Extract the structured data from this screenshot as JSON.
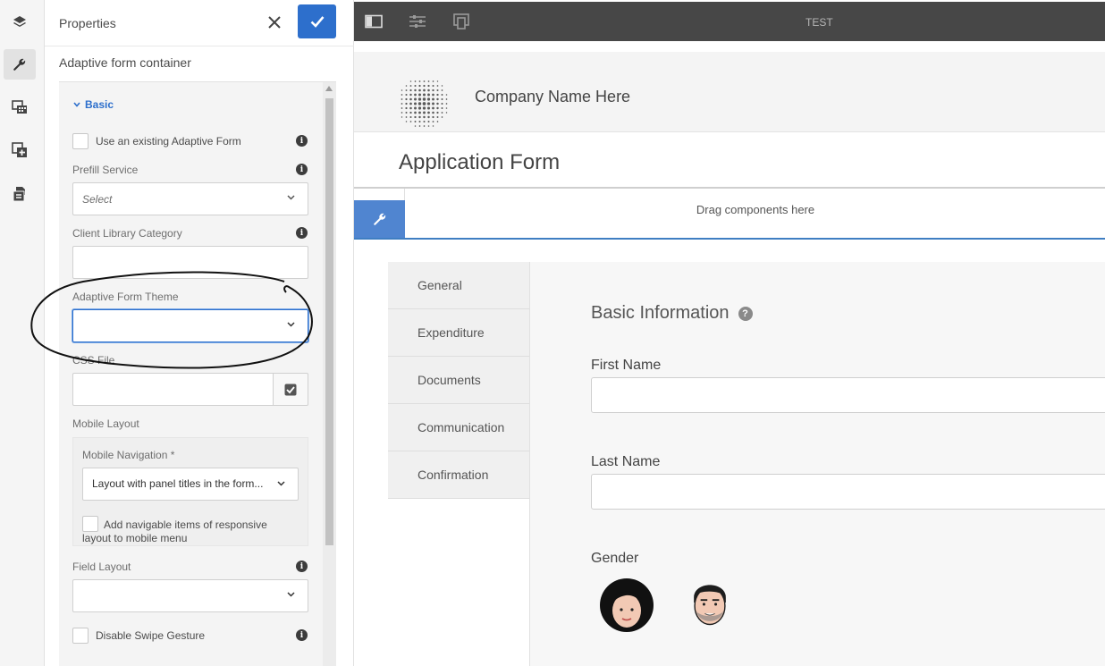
{
  "panel": {
    "title": "Properties",
    "subtitle": "Adaptive form container",
    "section": "Basic",
    "use_existing_label": "Use an existing Adaptive Form",
    "prefill_label": "Prefill Service",
    "prefill_placeholder": "Select",
    "client_lib_label": "Client Library Category",
    "theme_label": "Adaptive Form Theme",
    "css_file_label": "CSS File",
    "mobile_layout_label": "Mobile Layout",
    "mobile_nav_label": "Mobile Navigation *",
    "mobile_nav_value": "Layout with panel titles in the form...",
    "add_navigable_label": "Add navigable items of responsive layout to mobile menu",
    "field_layout_label": "Field Layout",
    "disable_swipe_label": "Disable Swipe Gesture"
  },
  "canvas": {
    "top_title": "TEST",
    "company": "Company Name Here",
    "form_title": "Application Form",
    "drag_text": "Drag components here",
    "nav": [
      "General",
      "Expenditure",
      "Documents",
      "Communication",
      "Confirmation"
    ],
    "section_title": "Basic Information",
    "first_name": "First Name",
    "last_name": "Last Name",
    "gender": "Gender"
  },
  "colors": {
    "accent": "#2d6fcc",
    "toolbar": "#474747",
    "annotation": "#000000"
  }
}
